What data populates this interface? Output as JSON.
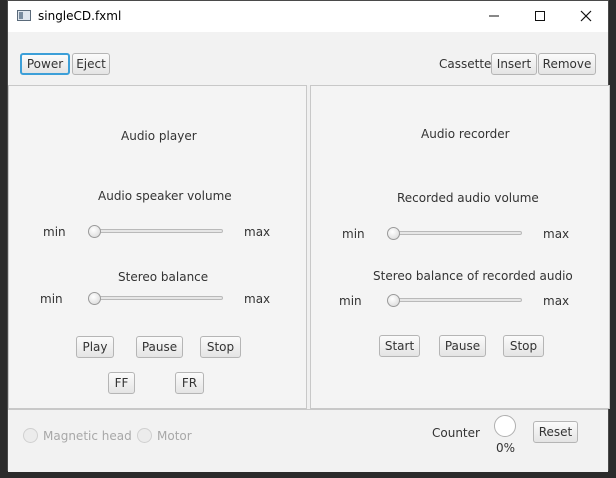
{
  "window": {
    "title": "singleCD.fxml"
  },
  "toolbar": {
    "power": "Power",
    "eject": "Eject",
    "cassette_label": "Cassette",
    "insert": "Insert",
    "remove": "Remove"
  },
  "player": {
    "title": "Audio player",
    "volume_label": "Audio speaker volume",
    "volume_min": "min",
    "volume_max": "max",
    "volume_value": 0,
    "balance_label": "Stereo balance",
    "balance_min": "min",
    "balance_max": "max",
    "balance_value": 0,
    "buttons": {
      "play": "Play",
      "pause": "Pause",
      "stop": "Stop",
      "ff": "FF",
      "fr": "FR"
    }
  },
  "recorder": {
    "title": "Audio recorder",
    "volume_label": "Recorded audio volume",
    "volume_min": "min",
    "volume_max": "max",
    "volume_value": 0,
    "balance_label": "Stereo balance of recorded audio",
    "balance_min": "min",
    "balance_max": "max",
    "balance_value": 0,
    "buttons": {
      "start": "Start",
      "pause": "Pause",
      "stop": "Stop"
    }
  },
  "status": {
    "magnetic_head": "Magnetic head",
    "motor": "Motor",
    "counter_label": "Counter",
    "progress": "0%",
    "reset": "Reset"
  },
  "icons": {
    "app": "window-app-icon",
    "minimize": "minimize-icon",
    "maximize": "maximize-icon",
    "close": "close-icon"
  }
}
